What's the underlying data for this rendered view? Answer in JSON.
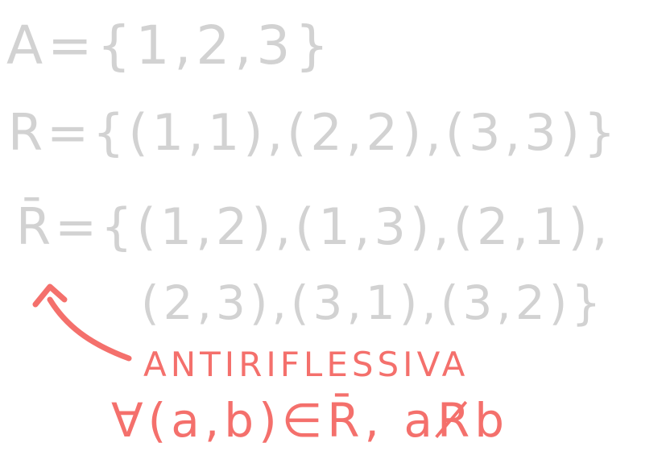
{
  "colors": {
    "background": "#ffffff",
    "ink_gray": "#d2d2d2",
    "ink_red": "#f4706c"
  },
  "lines": {
    "set_a": "A={1,2,3}",
    "relation_r": "R={(1,1),(2,2),(3,3)}",
    "complement_r_line1": "R̄={(1,2),(1,3),(2,1),",
    "complement_r_line2": "(2,3),(3,1),(3,2)}"
  },
  "annotation": {
    "label": "ANTIRIFLESSIVA",
    "formula": "∀(a,b)∈R̄, aR̸b"
  }
}
